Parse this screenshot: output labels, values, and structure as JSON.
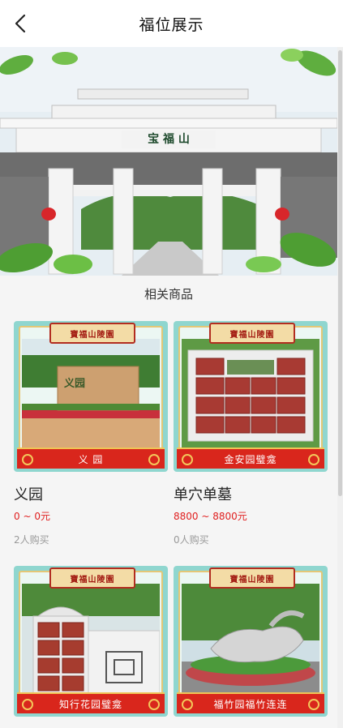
{
  "header": {
    "title": "福位展示"
  },
  "banner": {
    "gate_sign": "宝 福 山"
  },
  "section": {
    "title": "相关商品"
  },
  "brand_plaque": "寶福山陵園",
  "products": [
    {
      "ribbon": "义 园",
      "name": "义园",
      "price": "0 ~ 0元",
      "sold": "2人购买",
      "photo_sign": "义园"
    },
    {
      "ribbon": "金安园璧龛",
      "name": "单穴单墓",
      "price": "8800 ~ 8800元",
      "sold": "0人购买"
    },
    {
      "ribbon": "知行花园璧龛"
    },
    {
      "ribbon": "福竹园福竹连连"
    }
  ],
  "colors": {
    "price": "#e02020",
    "ribbon": "#d9261c",
    "card_border": "#8fd6cf"
  }
}
